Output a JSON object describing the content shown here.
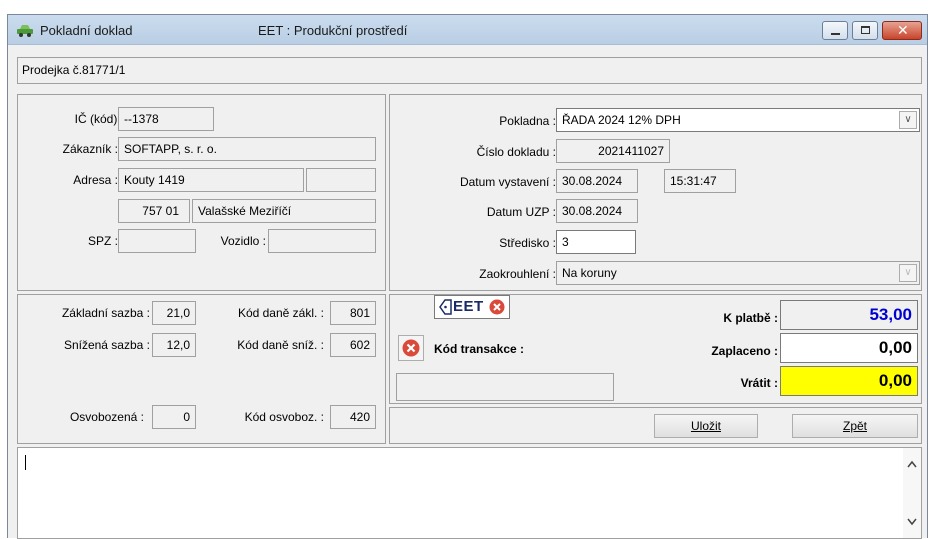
{
  "window": {
    "title": "Pokladní doklad",
    "environment": "EET : Produkční prostředí",
    "document_label": "Prodejka č.81771/1"
  },
  "customer": {
    "ic_label": "IČ  (kód) :",
    "ic_value": "--1378",
    "customer_label": "Zákazník :",
    "customer_value": "SOFTAPP, s. r. o.",
    "address_label": "Adresa :",
    "street": "Kouty 1419",
    "street2": "",
    "zip": "757 01",
    "city": "Valašské Meziříčí",
    "spz_label": "SPZ :",
    "spz_value": "",
    "vehicle_label": "Vozidlo :",
    "vehicle_value": ""
  },
  "document": {
    "register_label": "Pokladna :",
    "register_value": "ŘADA 2024 12% DPH",
    "number_label": "Číslo dokladu :",
    "number_value": "2021411027",
    "issue_label": "Datum vystavení :",
    "issue_date": "30.08.2024",
    "issue_time": "15:31:47",
    "duzp_label": "Datum UZP :",
    "duzp_value": "30.08.2024",
    "center_label": "Středisko :",
    "center_value": "3",
    "rounding_label": "Zaokrouhlení :",
    "rounding_value": "Na koruny"
  },
  "vat": {
    "base_rate_label": "Základní sazba :",
    "base_rate_value": "21,0",
    "base_code_label": "Kód daně zákl. :",
    "base_code_value": "801",
    "reduced_rate_label": "Snížená sazba :",
    "reduced_rate_value": "12,0",
    "reduced_code_label": "Kód daně sníž. :",
    "reduced_code_value": "602",
    "exempt_label": "Osvobozená :",
    "exempt_value": "0",
    "exempt_code_label": "Kód osvoboz. :",
    "exempt_code_value": "420"
  },
  "eet": {
    "badge": "EET",
    "transaction_label": "Kód transakce :",
    "transaction_value": ""
  },
  "totals": {
    "to_pay_label": "K platbě :",
    "to_pay_value": "53,00",
    "paid_label": "Zaplaceno :",
    "paid_value": "0,00",
    "return_label": "Vrátit :",
    "return_value": "0,00",
    "to_pay_color": "#0000d0",
    "return_bg": "#ffff00"
  },
  "buttons": {
    "save": "Uložit",
    "back": "Zpět"
  },
  "note": {
    "text": ""
  }
}
